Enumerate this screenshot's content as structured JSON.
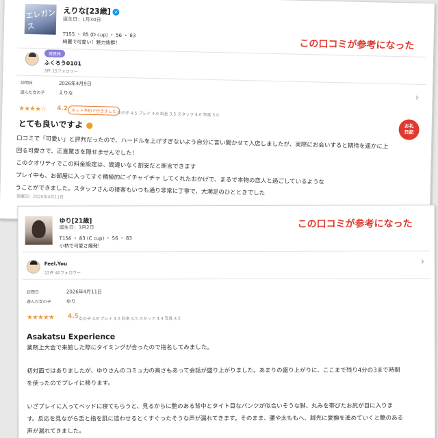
{
  "card1": {
    "photo_watermark": "エレガンス",
    "girl_name": "えりな[23歳]",
    "birthday": "誕生日：1月30日",
    "specs": "T155 ・ 85 (D cup) ・ 56 ・ 83",
    "tagline": "綺麗で可愛い！魅力抜群！",
    "helpful_label": "この口コミが参考になった",
    "reviewer_rank": "成長株",
    "reviewer_name": "ふくろう0101",
    "reviewer_stats": "3件 15フォロワー",
    "visit_label": "訪問日",
    "visit_value": "2026年4月9日",
    "companion_label": "遊んだ女の子",
    "companion_value": "えりな",
    "stars": "★★★★☆",
    "score": "4.2",
    "net_badge": "ネット予約で行きました",
    "subscores": "女の子 4.5 プレイ 4.0 料金 3.5 スタッフ 4.0 写真 5.0",
    "diary_stamp_line1": "お礼",
    "diary_stamp_line2": "日記",
    "review_title": "とても良いですよ",
    "body_lines": [
      "口コミで「可愛い」と評判だったので、ハードルを上げすぎないよう自分に言い聞かせて入店しましたが、実際にお会いすると期待を遥かに上",
      "回る可愛さで、正直驚きを隠せませんでした！",
      "このクオリティでこの料金設定は、間違いなく割安だと断言できます",
      "プレイ中も、お部屋に入ってすぐ積極的にイチャイチャ してくれたおかげで、まるで本物の恋人と過ごしているような",
      "うことができました。スタッフさんの接客もいつも通り非常に丁寧で、大満足のひとときでした"
    ],
    "posted": "掲載日：2026年4月11日"
  },
  "card2": {
    "girl_name": "ゆり[21歳]",
    "birthday": "誕生日：3月2日",
    "specs": "T156 ・ 83 (C cup) ・ 56 ・ 83",
    "tagline": "小柄で可愛さ爆発！",
    "helpful_label": "この口コミが参考になった",
    "reviewer_name": "Feel.You",
    "reviewer_stats": "22件 40フォロワー",
    "visit_label": "訪問日",
    "visit_value": "2026年4月11日",
    "companion_label": "遊んだ女の子",
    "companion_value": "ゆり",
    "stars": "★★★★★",
    "score": "4.5",
    "subscores": "女の子 4.8 プレイ 4.5 料金 4.5 スタッフ 4.4 写真 4.5",
    "review_title": "Asakatsu Experience",
    "body_lines": [
      "業務上大会で来館した際にタイミングが合ったので指名してみました。",
      "初対面ではありましたが、ゆりさんのコミュ力の高さもあって会話が盛り上がりました。あまりの盛り上がりに、ここまで残り4分の3まで時間",
      "を使ったのでプレイに移ります。",
      "いざプレイに入ってベッドに寝てもらうと、見るからに艶のある背中とタイト目なパンツが似合いそうな脚、丸みを帯びたお尻が目に入りま",
      "す。反応を見ながら舌と指を肌に這わせるとくすぐったそうな声が漏れてきます。そのまま、腰や太ももへ、脚先に愛撫を進めていくと艶のある",
      "声が漏れてきました。"
    ]
  },
  "colors": {
    "accent_red": "#e03a2e",
    "star_orange": "#e8a04a",
    "rank_purple": "#8a7fd8",
    "verified_blue": "#1d9bf0"
  }
}
